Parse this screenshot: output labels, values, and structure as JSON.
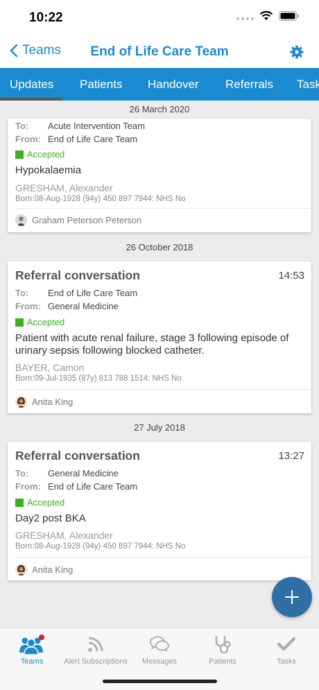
{
  "status_bar": {
    "time": "10:22"
  },
  "nav": {
    "back_label": "Teams",
    "title": "End of Life Care Team"
  },
  "tabs": [
    {
      "label": "Updates",
      "active": true
    },
    {
      "label": "Patients"
    },
    {
      "label": "Handover"
    },
    {
      "label": "Referrals"
    },
    {
      "label": "Task"
    }
  ],
  "feed": [
    {
      "date": "26 March 2020",
      "card": {
        "to_label": "To:",
        "to": "Acute Intervention Team",
        "from_label": "From:",
        "from": "End of Life Care Team",
        "status": "Accepted",
        "body": "Hypokalaemia",
        "patient_name": "GRESHAM, Alexander",
        "patient_info": "Born:08-Aug-1928 (94y) 450 897 7944: NHS No",
        "author": "Graham Peterson Peterson"
      }
    },
    {
      "date": "26 October 2018",
      "card": {
        "title": "Referral conversation",
        "time": "14:53",
        "to_label": "To:",
        "to": "End of Life Care Team",
        "from_label": "From:",
        "from": "General Medicine",
        "status": "Accepted",
        "body": "Patient with acute renal failure, stage 3 following episode of urinary sepsis following blocked catheter.",
        "patient_name": "BAYER, Camon",
        "patient_info": "Born:09-Jul-1935 (87y) 813 788 1514: NHS No",
        "author": "Anita King"
      }
    },
    {
      "date": "27 July 2018",
      "card": {
        "title": "Referral conversation",
        "time": "13:27",
        "to_label": "To:",
        "to": "General Medicine",
        "from_label": "From:",
        "from": "End of Life Care Team",
        "status": "Accepted",
        "body": "Day2 post BKA",
        "patient_name": "GRESHAM, Alexander",
        "patient_info": "Born:08-Aug-1928 (94y) 450 897 7944: NHS No",
        "author": "Anita King"
      }
    }
  ],
  "bottom_nav": [
    {
      "label": "Teams",
      "icon": "teams-icon",
      "active": true,
      "badge": true
    },
    {
      "label": "Alert Subscriptions",
      "icon": "rss-icon"
    },
    {
      "label": "Messages",
      "icon": "messages-icon"
    },
    {
      "label": "Patients",
      "icon": "stethoscope-icon"
    },
    {
      "label": "Tasks",
      "icon": "checkmark-icon"
    }
  ],
  "colors": {
    "accent": "#1a8bd0",
    "accepted": "#3cb01e",
    "fab": "#2f6fa6"
  }
}
